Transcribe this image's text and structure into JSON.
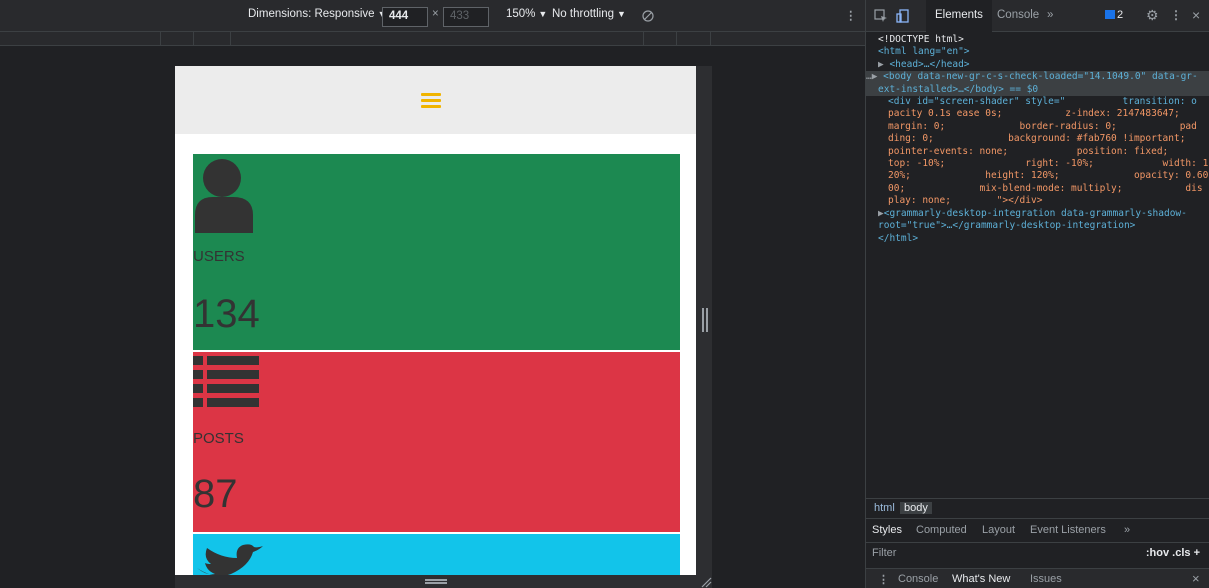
{
  "device_toolbar": {
    "dimensions_label": "Dimensions: Responsive",
    "width_value": "444",
    "times": "×",
    "height_placeholder": "433",
    "zoom_label": "150%",
    "throttling_label": "No throttling"
  },
  "page": {
    "cards": [
      {
        "label": "USERS",
        "value": "134",
        "color": "#1c8951",
        "icon": "user-icon"
      },
      {
        "label": "POSTS",
        "value": "87",
        "color": "#dc3545",
        "icon": "list-icon"
      },
      {
        "label": "",
        "value": "",
        "color": "#12c4ea",
        "icon": "twitter-bird-icon"
      }
    ],
    "accent": "#f0b400"
  },
  "devtools": {
    "tabs": {
      "elements": "Elements",
      "console": "Console",
      "more": "»"
    },
    "issues_count": "2",
    "dom": {
      "doctype": "<!DOCTYPE html>",
      "html_open": "<html lang=\"en\">",
      "head": "<head>…</head>",
      "body_line1": "<body data-new-gr-c-s-check-loaded=\"14.1049.0\" data-gr-",
      "body_line2": "ext-installed>…</body> == $0",
      "div_lines": [
        "<div id=\"screen-shader\" style=\"          transition: o",
        "pacity 0.1s ease 0s;           z-index: 2147483647;",
        "margin: 0;             border-radius: 0;           pad",
        "ding: 0;             background: #fab760 !important;",
        "pointer-events: none;            position: fixed;",
        "top: -10%;              right: -10%;            width: 1",
        "20%;             height: 120%;             opacity: 0.60",
        "00;             mix-blend-mode: multiply;           dis",
        "play: none;        \"></div>"
      ],
      "grammarly_line1": "<grammarly-desktop-integration data-grammarly-shadow-",
      "grammarly_line2": "root=\"true\">…</grammarly-desktop-integration>",
      "html_close": "</html>"
    },
    "breadcrumbs": [
      "html",
      "body"
    ],
    "styles_tabs": [
      "Styles",
      "Computed",
      "Layout",
      "Event Listeners",
      "»"
    ],
    "filter_placeholder": "Filter",
    "filter_right": ":hov  .cls  +",
    "drawer_tabs": [
      "Console",
      "What's New",
      "Issues"
    ],
    "drawer_close": "×",
    "close_devtools": "×"
  }
}
